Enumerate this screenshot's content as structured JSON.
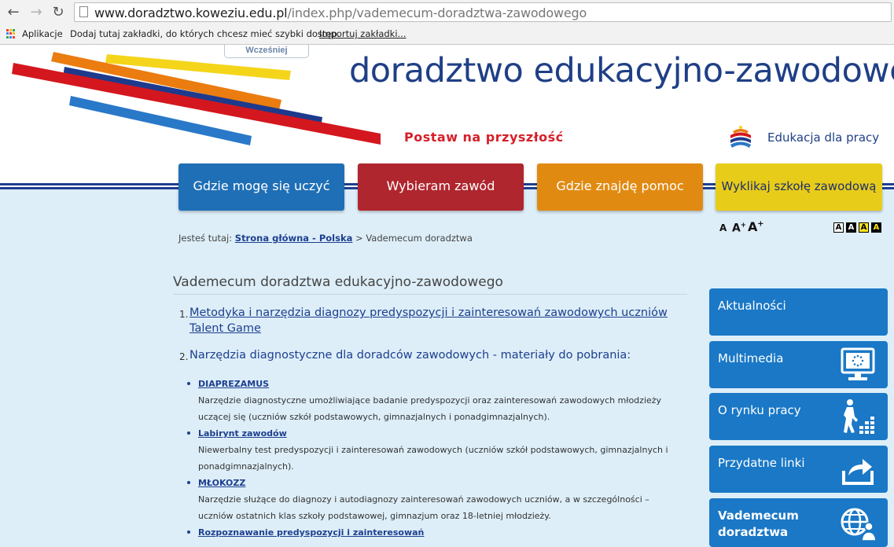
{
  "browser": {
    "url_domain": "www.doradztwo.koweziu.edu.pl",
    "url_path": "/index.php/vademecum-doradztwa-zawodowego",
    "bookmarks": {
      "apps_label": "Aplikacje",
      "hint": "Dodaj tutaj zakładki, do których chcesz mieć szybki dostęp.",
      "import_label": "Importuj zakładki..."
    }
  },
  "header": {
    "tab_label": "Wcześniej",
    "site_title": "doradztwo edukacyjno-zawodowe",
    "slogan": "Postaw na przyszłość",
    "partner_label": "Edukacja dla pracy"
  },
  "main_nav": [
    {
      "label": "Gdzie mogę się uczyć",
      "color": "#1f6fb6"
    },
    {
      "label": "Wybieram zawód",
      "color": "#b0262e"
    },
    {
      "label": "Gdzie znajdę pomoc",
      "color": "#e18a12"
    },
    {
      "label": "Wyklikaj szkołę zawodową",
      "color": "#e8cc1a"
    }
  ],
  "font_size": {
    "small": "A",
    "medium": "A+",
    "large": "A+"
  },
  "contrast_options": [
    "A",
    "A",
    "A",
    "A"
  ],
  "breadcrumb": {
    "prefix": "Jesteś tutaj:",
    "home": "Strona główna - Polska",
    "separator": ">",
    "current": "Vademecum doradztwa"
  },
  "content": {
    "title": "Vademecum doradztwa edukacyjno-zawodowego",
    "items": [
      {
        "num": "1.",
        "text": "Metodyka i narzędzia diagnozy predyspozycji i zainteresowań zawodowych uczniów Talent Game"
      },
      {
        "num": "2.",
        "text": "Narzędzia diagnostyczne dla doradców zawodowych - materiały do pobrania:"
      }
    ],
    "subitems": [
      {
        "title": "DIAPREZAMUS",
        "desc": "Narzędzie diagnostyczne umożliwiające badanie predyspozycji oraz zainteresowań zawodowych młodzieży uczącej się (uczniów szkół podstawowych, gimnazjalnych i ponadgimnazjalnych)."
      },
      {
        "title": "Labirynt zawodów",
        "desc": "Niewerbalny test predyspozycji i zainteresowań zawodowych (uczniów szkół podstawowych, gimnazjalnych i ponadgimnazjalnych)."
      },
      {
        "title": "MŁOKOZZ",
        "desc": "Narzędzie służące do diagnozy i autodiagnozy zainteresowań zawodowych uczniów, a w szczególności – uczniów ostatnich klas szkoły podstawowej, gimnazjum oraz 18-letniej młodzieży."
      },
      {
        "title": "Rozpoznawanie predyspozycji i zainteresowań",
        "desc": ""
      }
    ]
  },
  "side_menu": [
    {
      "label": "Aktualności",
      "icon": "none"
    },
    {
      "label": "Multimedia",
      "icon": "monitor-icon"
    },
    {
      "label": "O rynku pracy",
      "icon": "stairs-person-icon"
    },
    {
      "label": "Przydatne linki",
      "icon": "share-arrow-icon"
    },
    {
      "label": "Vademecum doradztwa",
      "icon": "globe-person-icon"
    }
  ],
  "colors": {
    "brand_blue": "#1f3f86",
    "side_blue": "#1a78c6",
    "slogan_red": "#d71f29",
    "page_bg": "#ddeef8"
  }
}
